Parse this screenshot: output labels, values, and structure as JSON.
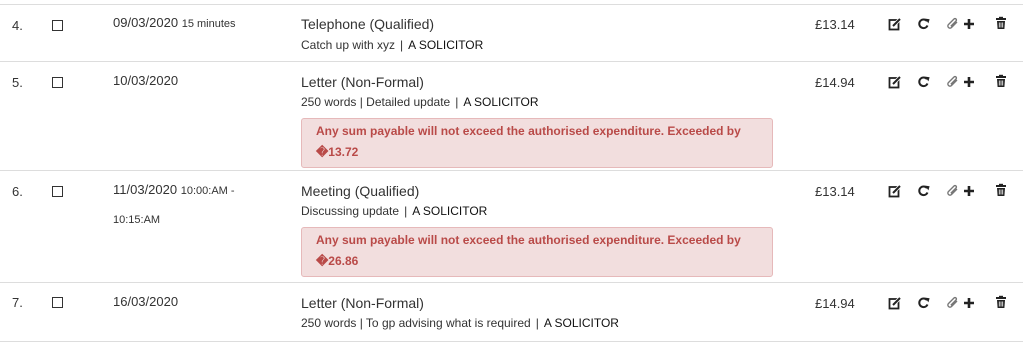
{
  "rows": [
    {
      "number": "4.",
      "date": "09/03/2020",
      "time_info": "15 minutes",
      "title": "Telephone (Qualified)",
      "desc": "Catch up with xyz",
      "solicitor": "A SOLICITOR",
      "amount": "£13.14"
    },
    {
      "number": "5.",
      "date": "10/03/2020",
      "title": "Letter (Non-Formal)",
      "desc": "250 words | Detailed update",
      "solicitor": "A SOLICITOR",
      "amount": "£14.94",
      "alert": "Any sum payable will not exceed the authorised expenditure. Exceeded by �13.72"
    },
    {
      "number": "6.",
      "date": "11/03/2020",
      "time_info": "10:00:AM -",
      "time_info2": "10:15:AM",
      "title": "Meeting (Qualified)",
      "desc": "Discussing update",
      "solicitor": "A SOLICITOR",
      "amount": "£13.14",
      "alert": "Any sum payable will not exceed the authorised expenditure. Exceeded by �26.86"
    },
    {
      "number": "7.",
      "date": "16/03/2020",
      "title": "Letter (Non-Formal)",
      "desc": "250 words | To gp advising what is required",
      "solicitor": "A SOLICITOR",
      "amount": "£14.94"
    }
  ],
  "icons": [
    "edit-icon",
    "redo-icon",
    "attach-add-icon",
    "trash-icon"
  ],
  "colors": {
    "alert_bg": "#f2dede",
    "alert_text": "#b94a48",
    "divider": "#dddddd"
  }
}
